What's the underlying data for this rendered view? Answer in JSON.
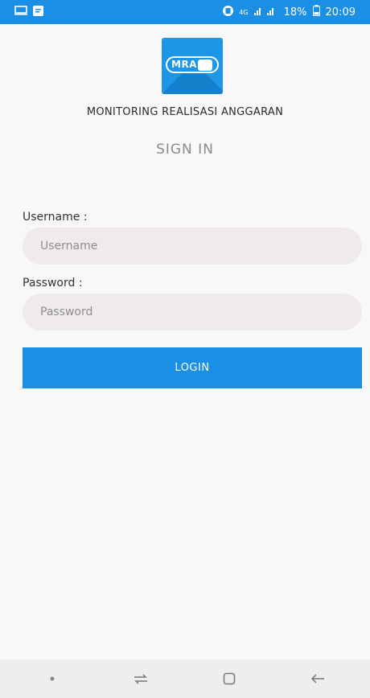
{
  "status_bar": {
    "network": "4G",
    "battery": "18%",
    "time": "20:09"
  },
  "logo": {
    "text": "MRA"
  },
  "header": {
    "app_title": "MONITORING REALISASI ANGGARAN",
    "screen_title": "SIGN IN"
  },
  "form": {
    "username_label": "Username :",
    "username_placeholder": "Username",
    "username_value": "",
    "password_label": "Password :",
    "password_placeholder": "Password",
    "password_value": "",
    "login_label": "LOGIN"
  },
  "colors": {
    "primary": "#1a8fe3",
    "field_bg": "#efebea",
    "background": "#f8f8f8"
  }
}
